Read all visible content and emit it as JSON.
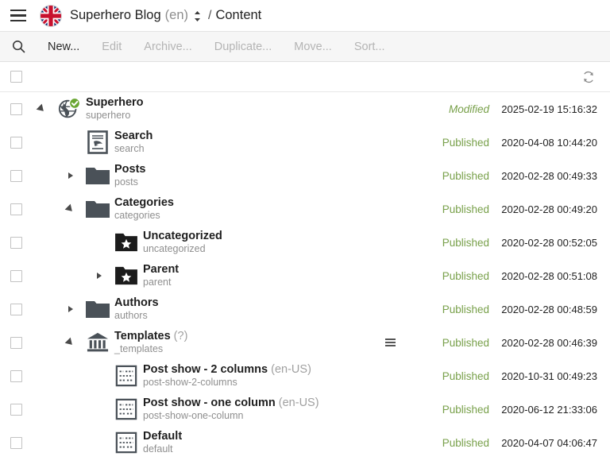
{
  "header": {
    "menu_icon": "hamburger-icon",
    "flag_icon": "uk-flag-icon",
    "site_name": "Superhero Blog",
    "site_lang": "(en)",
    "lang_switch_icon": "up-down-chevron-icon",
    "separator": "/",
    "breadcrumb": "Content"
  },
  "toolbar": {
    "search_icon": "search-icon",
    "buttons": [
      {
        "label": "New...",
        "enabled": true
      },
      {
        "label": "Edit",
        "enabled": false
      },
      {
        "label": "Archive...",
        "enabled": false
      },
      {
        "label": "Duplicate...",
        "enabled": false
      },
      {
        "label": "Move...",
        "enabled": false
      },
      {
        "label": "Sort...",
        "enabled": false
      }
    ]
  },
  "list_header": {
    "select_all_checkbox": "",
    "refresh_icon": "refresh-icon"
  },
  "rows": [
    {
      "title": "Superhero",
      "title_suffix": "",
      "slug": "superhero",
      "icon": "globe-published-icon",
      "indent": 0,
      "twisty": "open",
      "handle": false,
      "status": "Modified",
      "status_style": "modified",
      "date": "2025-02-19 15:16:32"
    },
    {
      "title": "Search",
      "title_suffix": "",
      "slug": "search",
      "icon": "search-page-icon",
      "indent": 1,
      "twisty": "none",
      "handle": false,
      "status": "Published",
      "status_style": "published",
      "date": "2020-04-08 10:44:20"
    },
    {
      "title": "Posts",
      "title_suffix": "",
      "slug": "posts",
      "icon": "folder-icon",
      "indent": 1,
      "twisty": "closed",
      "handle": false,
      "status": "Published",
      "status_style": "published",
      "date": "2020-02-28 00:49:33"
    },
    {
      "title": "Categories",
      "title_suffix": "",
      "slug": "categories",
      "icon": "folder-icon",
      "indent": 1,
      "twisty": "open",
      "handle": false,
      "status": "Published",
      "status_style": "published",
      "date": "2020-02-28 00:49:20"
    },
    {
      "title": "Uncategorized",
      "title_suffix": "",
      "slug": "uncategorized",
      "icon": "folder-star-icon",
      "indent": 2,
      "twisty": "none",
      "handle": false,
      "status": "Published",
      "status_style": "published",
      "date": "2020-02-28 00:52:05"
    },
    {
      "title": "Parent",
      "title_suffix": "",
      "slug": "parent",
      "icon": "folder-star-icon",
      "indent": 2,
      "twisty": "closed",
      "handle": false,
      "status": "Published",
      "status_style": "published",
      "date": "2020-02-28 00:51:08"
    },
    {
      "title": "Authors",
      "title_suffix": "",
      "slug": "authors",
      "icon": "folder-icon",
      "indent": 1,
      "twisty": "closed",
      "handle": false,
      "status": "Published",
      "status_style": "published",
      "date": "2020-02-28 00:48:59"
    },
    {
      "title": "Templates",
      "title_suffix": "(?)",
      "slug": "_templates",
      "icon": "bank-building-icon",
      "indent": 1,
      "twisty": "open",
      "handle": true,
      "status": "Published",
      "status_style": "published",
      "date": "2020-02-28 00:46:39"
    },
    {
      "title": "Post show - 2 columns",
      "title_suffix": "(en-US)",
      "slug": "post-show-2-columns",
      "icon": "template-wireframe-icon",
      "indent": 2,
      "twisty": "none",
      "handle": false,
      "status": "Published",
      "status_style": "published",
      "date": "2020-10-31 00:49:23"
    },
    {
      "title": "Post show - one column",
      "title_suffix": "(en-US)",
      "slug": "post-show-one-column",
      "icon": "template-wireframe-icon",
      "indent": 2,
      "twisty": "none",
      "handle": false,
      "status": "Published",
      "status_style": "published",
      "date": "2020-06-12 21:33:06"
    },
    {
      "title": "Default",
      "title_suffix": "",
      "slug": "default",
      "icon": "template-wireframe-icon",
      "indent": 2,
      "twisty": "none",
      "handle": false,
      "status": "Published",
      "status_style": "published",
      "date": "2020-04-07 04:06:47"
    }
  ],
  "colors": {
    "status_green": "#78a04a",
    "icon_dark": "#4a5158",
    "toolbar_bg": "#f6f6f6",
    "disabled_text": "#b4b4b4",
    "check_green": "#6aa632"
  }
}
